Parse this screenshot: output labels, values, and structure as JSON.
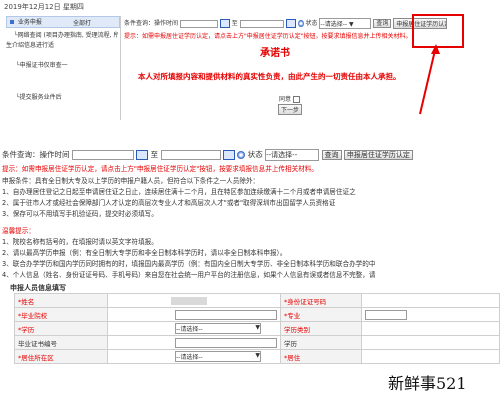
{
  "date_bar": "2019年12月12日 星期四",
  "top_left_menu": {
    "tab": "业务申报",
    "tab_extra": "全部打",
    "item1": "└网络查阅 (项目办理指南, 受理流程, 所需材料, 填写说明)",
    "item1b": "生介绍信息进行适",
    "item2": "└申报证书仅审查一",
    "item3": "└提交服务业件后",
    "item4": "└本人对所填报学历信"
  },
  "top_query": {
    "label": "条件查询：操作时间",
    "dash": "至",
    "status_label": "状态",
    "status_value": "--请选择-- ▼",
    "query_btn": "查询",
    "apply_btn": "申报居住证学历认定",
    "tip": "提示：如需申报居住证学历认定，请点击上方\"申报居住证学历认定\"按钮，按要求填报信息并上传相关材料。"
  },
  "promise": {
    "title": "承诺书",
    "text": "本人对所填报内容和提供材料的真实性负责，由此产生的一切责任由本人承担。",
    "agree_label": "同意",
    "next_btn": "下一步"
  },
  "query": {
    "label": "条件查询：操作时间",
    "dash": "至",
    "status_label": "状态",
    "status_value": "--请选择--",
    "query_btn": "查询",
    "apply_btn": "申报居住证学历认定"
  },
  "tip_line": "提示：如需申报居住证学历认定，请点击上方\"申报居住证学历认定\"按钮，按要求填报信息并上传相关材料。",
  "conditions": {
    "head": "申报条件：具有全日制大专及以上学历的申报户籍人员，但符合以下条件之一人员除外：",
    "items": [
      "1、自办理居住登记之日起至申请居住证之日止，连续居住满十二个月，且在特区参加连续缴满十二个月或者申请居住证之",
      "2、属于驻市人才或经社会保障部门人才认定的高层次专业人才和高层次人才\"或者\"取得深圳市出国留学人员资格证",
      "3、保存可以不用填写手机验证码，提交时必须填写。"
    ]
  },
  "notice": {
    "head": "温馨提示：",
    "items": [
      "1、院校名称有括号的，在填报时请以英文字符填报。",
      "2、请以最高学历申报（例：有全日制大专学历和非全日制本科学历时，请以非全日制本科申报）。",
      "3、联合办学学历和国内学历同时拥有的时，填报国内最高学历（例：有国内全日制大专学历、非全日制本科学历和联合办学的中",
      "4、个人信息（姓名、身份证证号码、手机号码）来自您在社会统一用户平台的注册信息，如果个人信息有误或者信息不完整，请"
    ]
  },
  "form": {
    "section_title": "申报人员信息填写",
    "name": "*姓名",
    "idno": "*身份证证号码",
    "school": "*毕业院校",
    "major": "*专业",
    "degree": "*学历",
    "degree_select": "--请选择--",
    "degree_type": "学历类别",
    "cert_no": "毕业证书编号",
    "study": "学历",
    "region": "*居住所在区",
    "region_select": "--请选择--",
    "residence": "*居住"
  },
  "watermark": "新鲜事521"
}
